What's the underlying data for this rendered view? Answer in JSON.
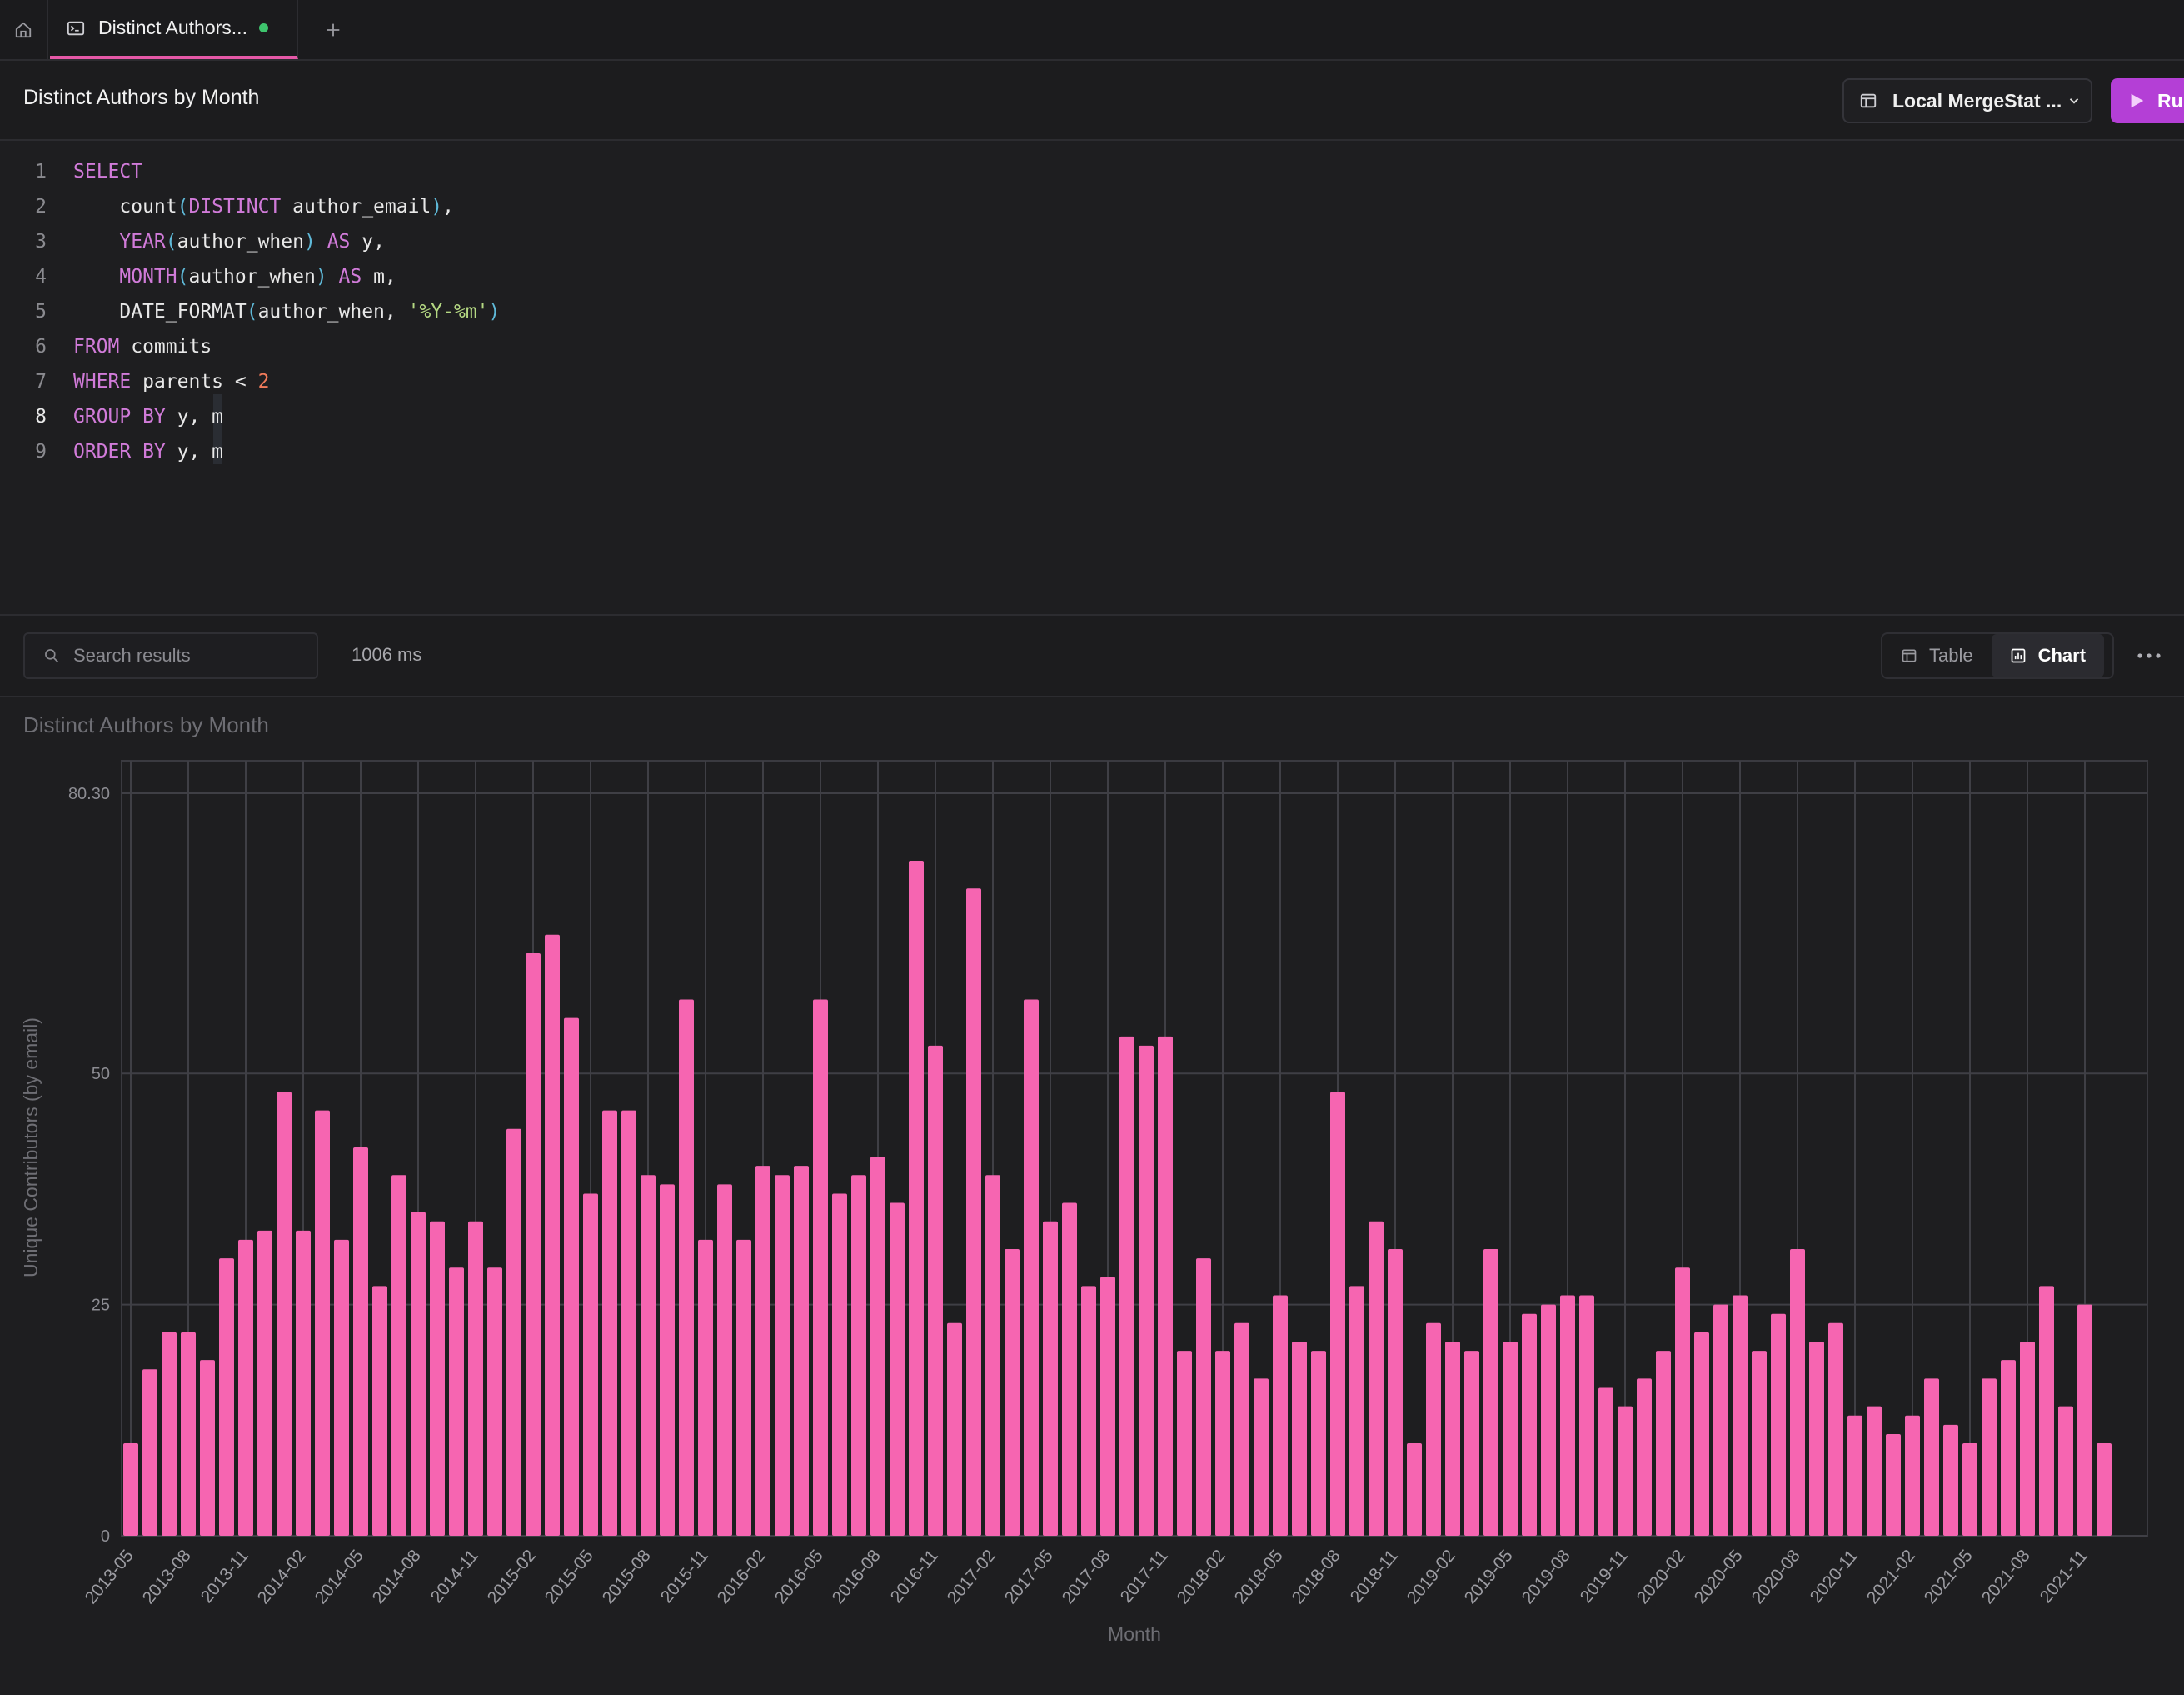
{
  "tabs": [
    {
      "label": "Distinct Authors...",
      "icon": "terminal-icon",
      "status_color": "#3ec46d"
    }
  ],
  "header": {
    "title": "Distinct Authors by Month",
    "database_label": "Local MergeStat ...",
    "run_label": "Run"
  },
  "editor": {
    "lines": [
      {
        "n": "1",
        "tokens": [
          [
            "kw",
            "SELECT"
          ]
        ]
      },
      {
        "n": "2",
        "tokens": [
          [
            "fn",
            "    count"
          ],
          [
            "pn",
            "("
          ],
          [
            "kw",
            "DISTINCT"
          ],
          [
            "fn",
            " author_email"
          ],
          [
            "pn",
            ")"
          ],
          [
            "fn",
            ","
          ]
        ]
      },
      {
        "n": "3",
        "tokens": [
          [
            "fnk",
            "    YEAR"
          ],
          [
            "pn",
            "("
          ],
          [
            "fn",
            "author_when"
          ],
          [
            "pn",
            ")"
          ],
          [
            "fn",
            " "
          ],
          [
            "kw",
            "AS"
          ],
          [
            "fn",
            " y,"
          ]
        ]
      },
      {
        "n": "4",
        "tokens": [
          [
            "fnk",
            "    MONTH"
          ],
          [
            "pn",
            "("
          ],
          [
            "fn",
            "author_when"
          ],
          [
            "pn",
            ")"
          ],
          [
            "fn",
            " "
          ],
          [
            "kw",
            "AS"
          ],
          [
            "fn",
            " m,"
          ]
        ]
      },
      {
        "n": "5",
        "tokens": [
          [
            "fn",
            "    DATE_FORMAT"
          ],
          [
            "pn",
            "("
          ],
          [
            "fn",
            "author_when, "
          ],
          [
            "str",
            "'%Y-%m'"
          ],
          [
            "pn",
            ")"
          ]
        ]
      },
      {
        "n": "6",
        "tokens": [
          [
            "kw",
            "FROM"
          ],
          [
            "fn",
            " commits"
          ]
        ]
      },
      {
        "n": "7",
        "tokens": [
          [
            "kw",
            "WHERE"
          ],
          [
            "fn",
            " parents < "
          ],
          [
            "num",
            "2"
          ]
        ]
      },
      {
        "n": "8",
        "tokens": [
          [
            "kw",
            "GROUP BY"
          ],
          [
            "fn",
            " y, m"
          ]
        ]
      },
      {
        "n": "9",
        "tokens": [
          [
            "kw",
            "ORDER BY"
          ],
          [
            "fn",
            " y, m"
          ]
        ]
      }
    ],
    "active_line": "8"
  },
  "results": {
    "search_placeholder": "Search results",
    "elapsed": "1006 ms",
    "view_table_label": "Table",
    "view_chart_label": "Chart",
    "active_view": "Chart"
  },
  "chart_data": {
    "type": "bar",
    "title": "Distinct Authors by Month",
    "xlabel": "Month",
    "ylabel": "Unique Contributors (by email)",
    "ylim": [
      0,
      80.3
    ],
    "yticks": [
      "0",
      "25",
      "50",
      "80.30"
    ],
    "grid": true,
    "bar_color": "#f665b1",
    "categories": [
      "2013-05",
      "2013-06",
      "2013-07",
      "2013-08",
      "2013-09",
      "2013-10",
      "2013-11",
      "2013-12",
      "2014-01",
      "2014-02",
      "2014-03",
      "2014-04",
      "2014-05",
      "2014-06",
      "2014-07",
      "2014-08",
      "2014-09",
      "2014-10",
      "2014-11",
      "2014-12",
      "2015-01",
      "2015-02",
      "2015-03",
      "2015-04",
      "2015-05",
      "2015-06",
      "2015-07",
      "2015-08",
      "2015-09",
      "2015-10",
      "2015-11",
      "2015-12",
      "2016-01",
      "2016-02",
      "2016-03",
      "2016-04",
      "2016-05",
      "2016-06",
      "2016-07",
      "2016-08",
      "2016-09",
      "2016-10",
      "2016-11",
      "2016-12",
      "2017-01",
      "2017-02",
      "2017-03",
      "2017-04",
      "2017-05",
      "2017-06",
      "2017-07",
      "2017-08",
      "2017-09",
      "2017-10",
      "2017-11",
      "2017-12",
      "2018-01",
      "2018-02",
      "2018-03",
      "2018-04",
      "2018-05",
      "2018-06",
      "2018-07",
      "2018-08",
      "2018-09",
      "2018-10",
      "2018-11",
      "2018-12",
      "2019-01",
      "2019-02",
      "2019-03",
      "2019-04",
      "2019-05",
      "2019-06",
      "2019-07",
      "2019-08",
      "2019-09",
      "2019-10",
      "2019-11",
      "2019-12",
      "2020-01",
      "2020-02",
      "2020-03",
      "2020-04",
      "2020-05",
      "2020-06",
      "2020-07",
      "2020-08",
      "2020-09",
      "2020-10",
      "2020-11",
      "2020-12",
      "2021-01",
      "2021-02",
      "2021-03",
      "2021-04",
      "2021-05",
      "2021-06",
      "2021-07",
      "2021-08",
      "2021-09",
      "2021-10",
      "2021-11",
      "2021-12"
    ],
    "tick_labels": [
      "2013-05",
      "2013-08",
      "2013-11",
      "2014-02",
      "2014-05",
      "2014-08",
      "2014-11",
      "2015-02",
      "2015-05",
      "2015-08",
      "2015-11",
      "2016-02",
      "2016-05",
      "2016-08",
      "2016-11",
      "2017-02",
      "2017-05",
      "2017-08",
      "2017-11",
      "2018-02",
      "2018-05",
      "2018-08",
      "2018-11",
      "2019-02",
      "2019-05",
      "2019-08",
      "2019-11",
      "2020-02",
      "2020-05",
      "2020-08",
      "2020-11",
      "2021-02",
      "2021-05",
      "2021-08",
      "2021-11"
    ],
    "values": [
      10,
      18,
      22,
      22,
      19,
      30,
      32,
      33,
      48,
      33,
      46,
      32,
      42,
      27,
      39,
      35,
      34,
      29,
      34,
      29,
      44,
      63,
      65,
      56,
      37,
      46,
      46,
      39,
      38,
      58,
      32,
      38,
      32,
      40,
      39,
      40,
      58,
      37,
      39,
      41,
      36,
      73,
      53,
      23,
      70,
      39,
      31,
      58,
      34,
      36,
      27,
      28,
      54,
      53,
      54,
      20,
      30,
      20,
      23,
      17,
      26,
      21,
      20,
      48,
      27,
      34,
      31,
      10,
      23,
      21,
      20,
      31,
      21,
      24,
      25,
      26,
      26,
      16,
      14,
      17,
      20,
      29,
      22,
      25,
      26,
      20,
      24,
      31,
      21,
      23,
      13,
      14,
      11,
      13,
      17,
      12,
      10,
      17,
      19,
      21,
      27,
      14,
      25,
      10
    ]
  }
}
